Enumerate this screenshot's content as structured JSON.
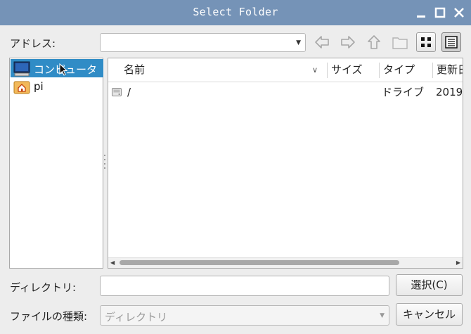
{
  "window": {
    "title": "Select Folder",
    "controls": [
      "minimize",
      "maximize",
      "close"
    ]
  },
  "address": {
    "label": "アドレス:",
    "value": ""
  },
  "toolbar": {
    "buttons": [
      "back-icon",
      "forward-icon",
      "up-icon",
      "new-folder-icon",
      "icon-view-icon",
      "detail-view-icon"
    ]
  },
  "sidebar": {
    "items": [
      {
        "label": "コンピュータ",
        "icon": "computer-icon",
        "selected": true
      },
      {
        "label": "pi",
        "icon": "home-folder-icon",
        "selected": false
      }
    ]
  },
  "filelist": {
    "columns": [
      "名前",
      "サイズ",
      "タイプ",
      "更新日"
    ],
    "rows": [
      {
        "name": "/",
        "size": "",
        "type": "ドライブ",
        "modified": "2019"
      }
    ]
  },
  "directory": {
    "label": "ディレクトリ:",
    "value": ""
  },
  "filetype": {
    "label": "ファイルの種類:",
    "selected": "ディレクトリ"
  },
  "buttons": {
    "select_label": "選択(C)",
    "cancel_label": "キャンセル"
  },
  "colors": {
    "titlebar": "#7593b7",
    "selection": "#308cc6"
  }
}
